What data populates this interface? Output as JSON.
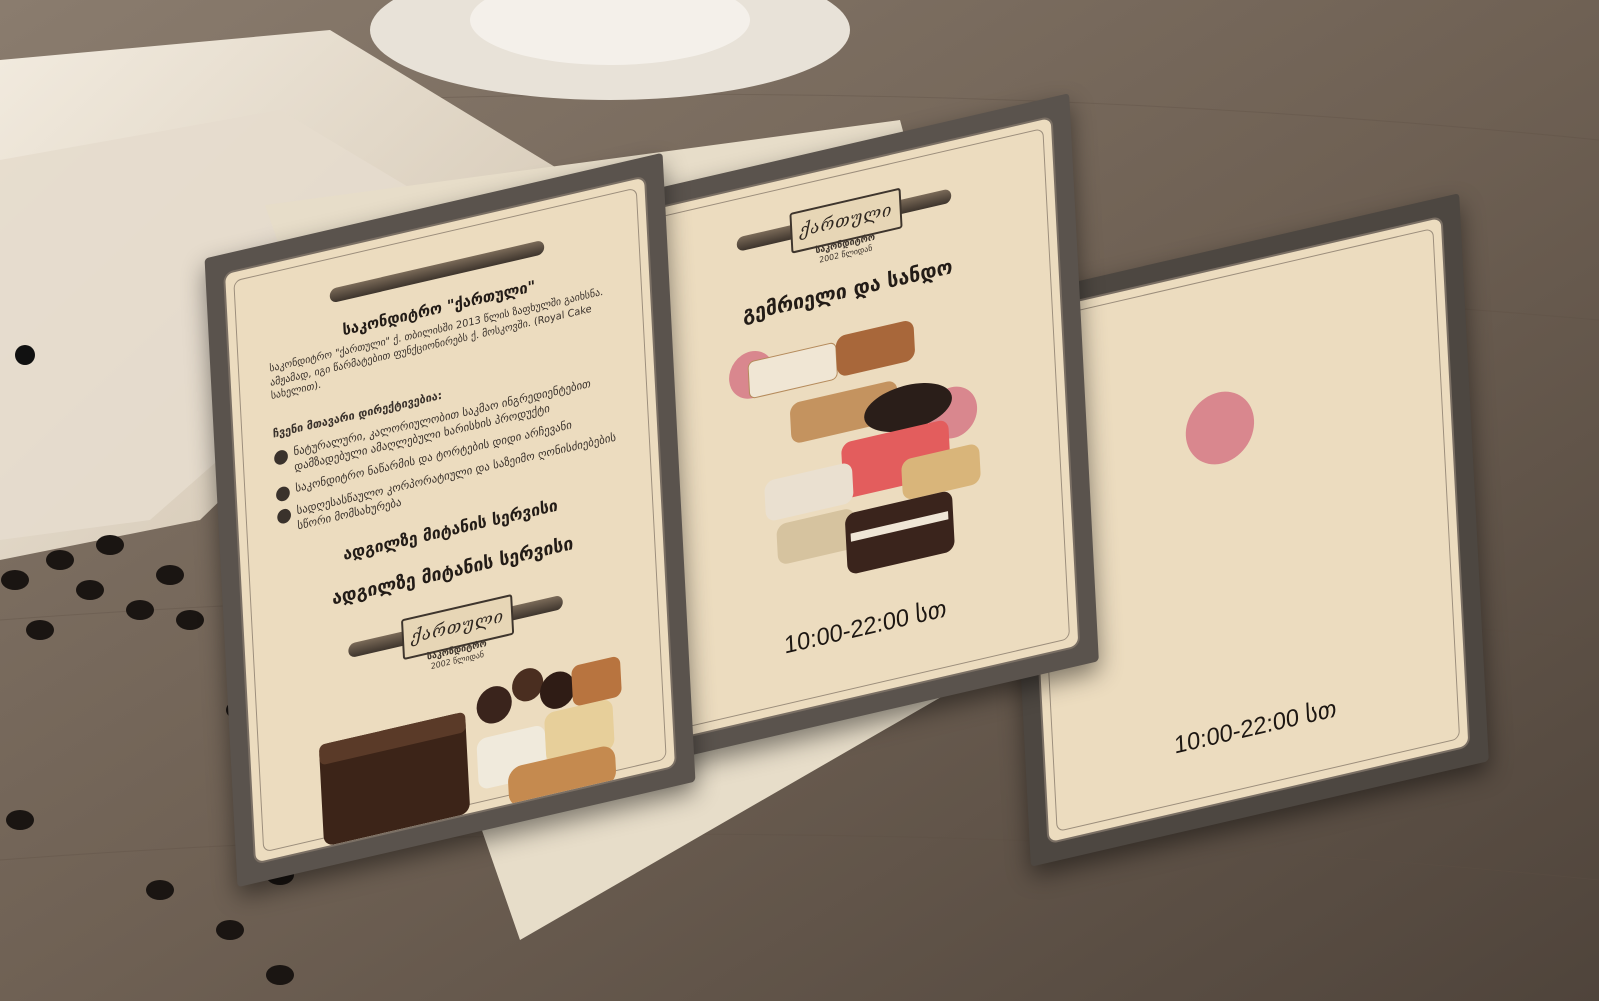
{
  "left_panel": {
    "heading": "საკონდიტრო \"ქართული\"",
    "intro": "საკონდიტრო \"ქართული\" ქ. თბილისში 2013 წლის ზაფხულში გაიხსნა. ამჟამად, იგი წარმატებით ფუნქციონირებს ქ. მოსკოვში. (Royal Cake სახელით).",
    "services_title": "ჩვენი მთავარი დირექტივებია:",
    "services": [
      "ნატურალური, კალორიულობით საკმაო ინგრედიენტებით დამზადებული ამაღლებული ხარისხის პროდუქტი",
      "საკონდიტრო ნაწარმის და ტორტების დიდი არჩევანი",
      "სადღესასწაულო კორპორატიული და საზეიმო ღონისძიებების სწორი მომსახურება"
    ],
    "delivery_title": "ადგილზე მიტანის სერვისი",
    "delivery_title2": "ადგილზე მიტანის სერვისი"
  },
  "logo": {
    "name": "ქართული",
    "subtitle": "საკონდიტრო",
    "year": "2002 წლიდან"
  },
  "middle_panel": {
    "title": "გემრიელი და სანდო",
    "hours": "10:00-22:00 სთ"
  },
  "back_panel": {
    "hours": "10:00-22:00 სთ"
  },
  "colors": {
    "paper": "#ecdcbf",
    "frame": "#5a534d",
    "accent_pink": "#d9878e"
  }
}
